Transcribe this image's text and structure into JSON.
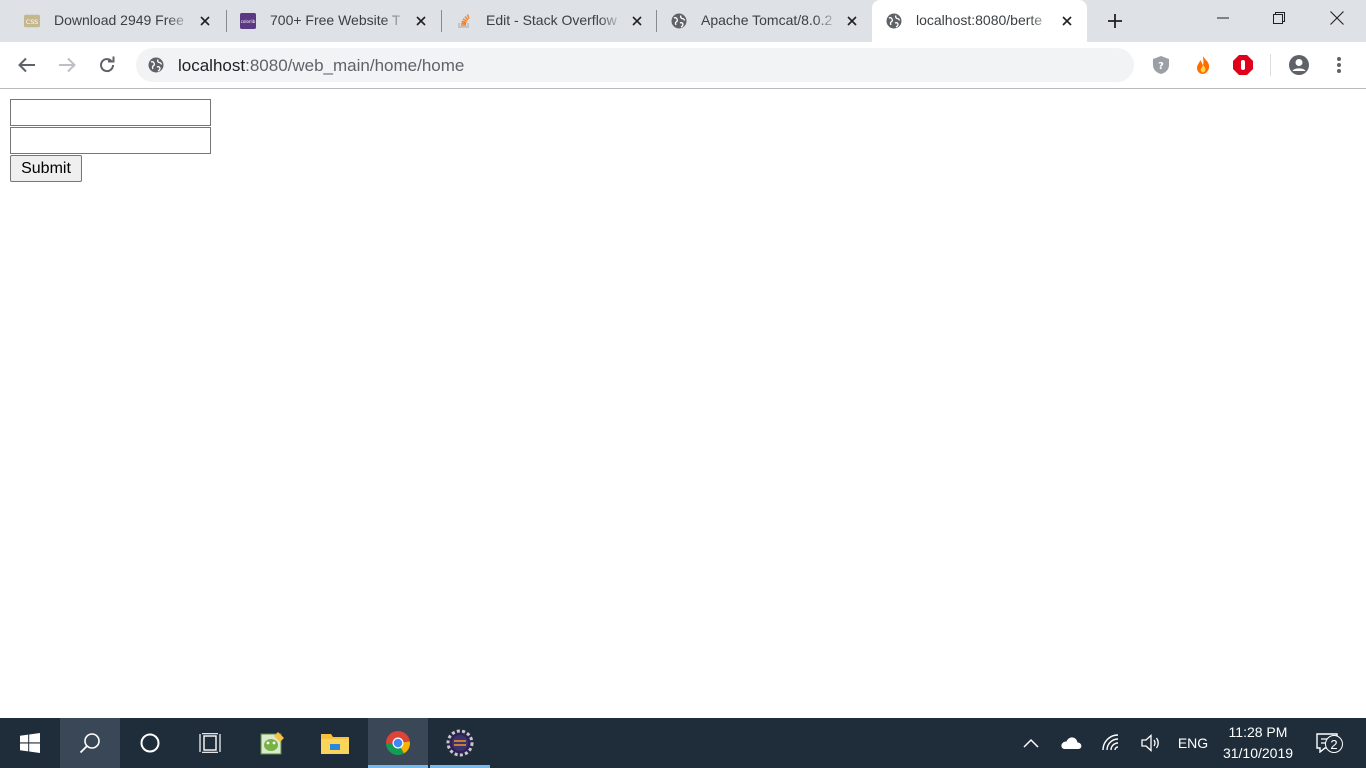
{
  "browser": {
    "tabs": [
      {
        "title": "Download 2949 Free",
        "favicon": "css-icon",
        "active": false
      },
      {
        "title": "700+ Free Website T",
        "favicon": "colorlib-icon",
        "active": false
      },
      {
        "title": "Edit - Stack Overflow",
        "favicon": "stack-overflow-icon",
        "active": false
      },
      {
        "title": "Apache Tomcat/8.0.2",
        "favicon": "globe-icon",
        "active": false
      },
      {
        "title": "localhost:8080/berte",
        "favicon": "globe-icon",
        "active": true
      }
    ],
    "favicon_labels": {
      "css": "CSS",
      "colorlib": "colorlib"
    },
    "address": {
      "host": "localhost",
      "path": ":8080/web_main/home/home"
    },
    "colors": {
      "tabstrip": "#dee1e6",
      "accent_red": "#e0001b"
    }
  },
  "page": {
    "form": {
      "field1_value": "",
      "field2_value": "",
      "submit_label": "Submit"
    }
  },
  "taskbar": {
    "apps": [
      "start-icon",
      "search-icon",
      "cortana-icon",
      "task-view-icon",
      "notepad-plus-icon",
      "file-explorer-icon",
      "chrome-icon",
      "eclipse-ee-icon"
    ],
    "language": "ENG",
    "time": "11:28 PM",
    "date": "31/10/2019",
    "notification_count": "2"
  }
}
